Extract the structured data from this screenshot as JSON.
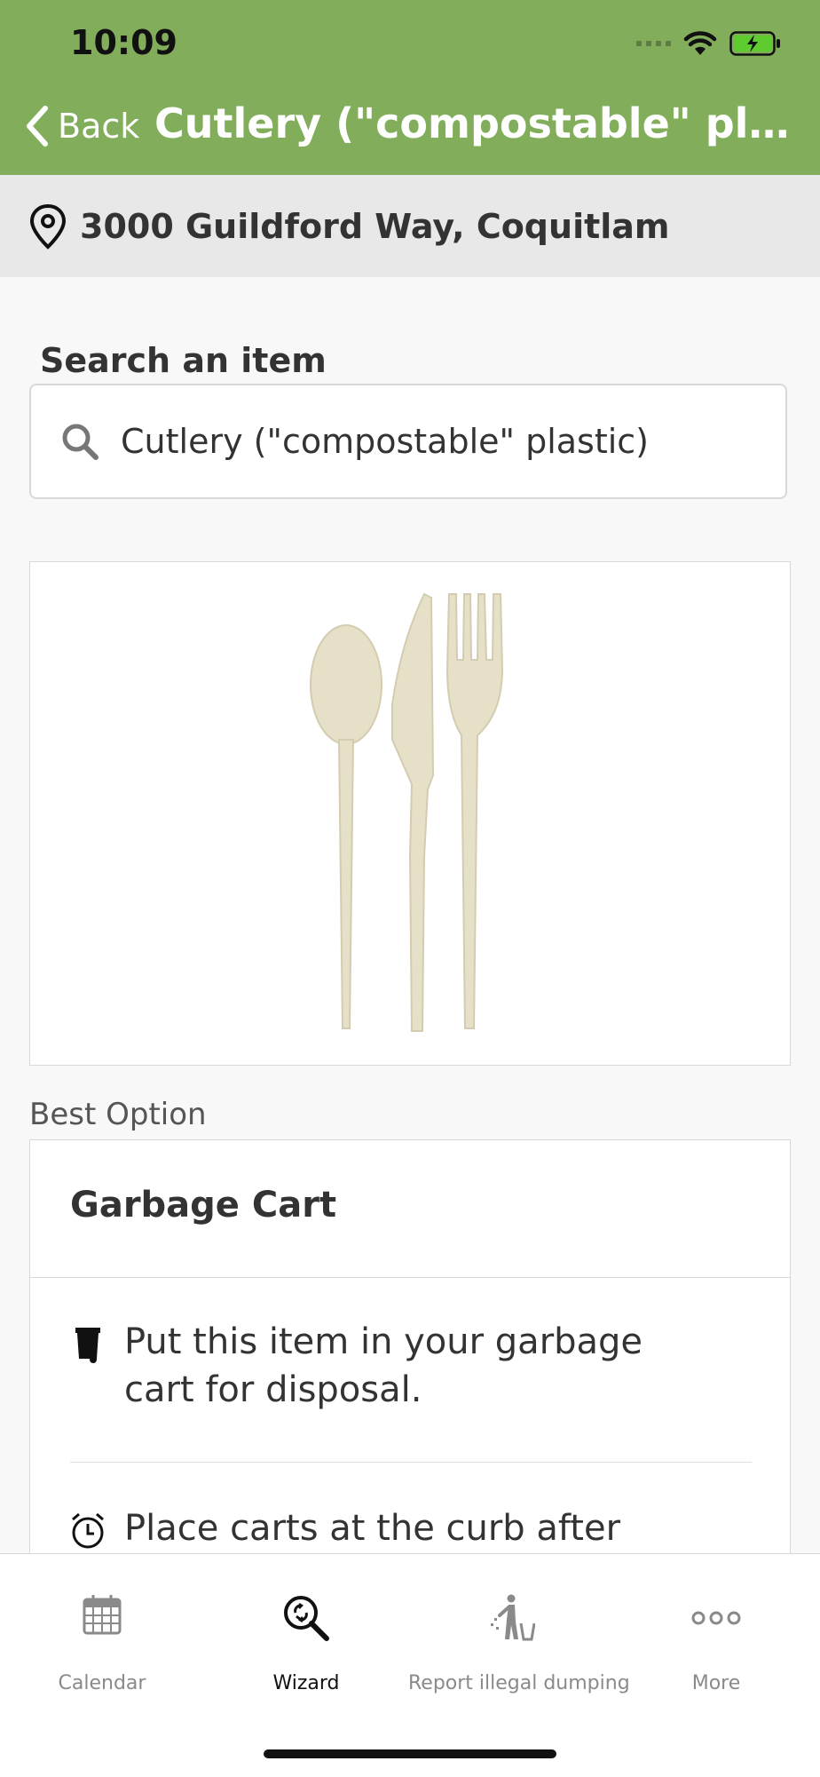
{
  "status_bar": {
    "time": "10:09"
  },
  "nav": {
    "back_label": "Back",
    "title": "Cutlery (\"compostable\" plastic)"
  },
  "location": {
    "address": "3000 Guildford Way, Coquitlam"
  },
  "search": {
    "label": "Search an item",
    "value": "Cutlery (\"compostable\" plastic)"
  },
  "best_option": {
    "label": "Best Option",
    "title": "Garbage Cart",
    "instructions": [
      {
        "icon": "garbage-cart-icon",
        "text": "Put this item in your garbage cart for disposal."
      },
      {
        "icon": "alarm-clock-icon",
        "text": "Place carts at the curb after"
      }
    ]
  },
  "tabs": [
    {
      "label": "Calendar",
      "icon": "calendar-icon",
      "active": false
    },
    {
      "label": "Wizard",
      "icon": "wizard-search-icon",
      "active": true
    },
    {
      "label": "Report illegal dumping",
      "icon": "dumping-icon",
      "active": false
    },
    {
      "label": "More",
      "icon": "more-dots-icon",
      "active": false
    }
  ],
  "colors": {
    "header": "#82ad5b",
    "battery": "#5ecb2f"
  }
}
